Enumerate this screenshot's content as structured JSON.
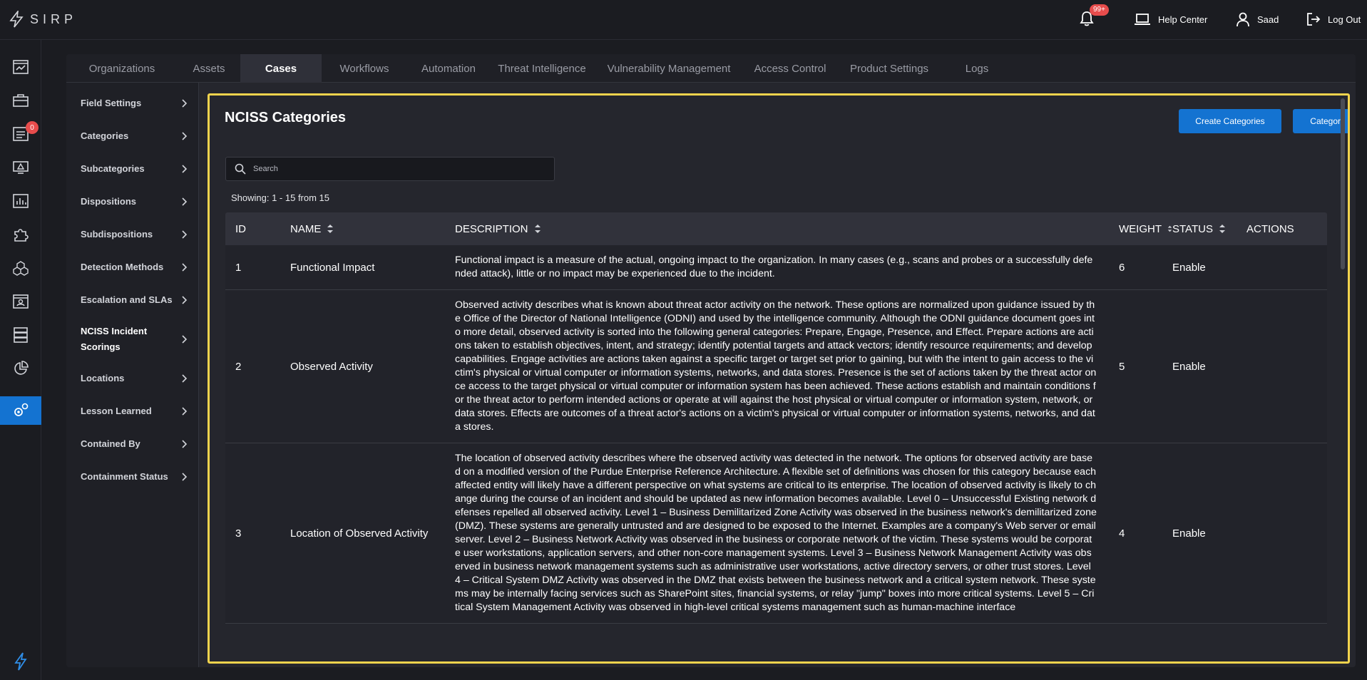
{
  "app": {
    "logo_text": "SIRP"
  },
  "topbar": {
    "notifications_badge": "99+",
    "help_label": "Help Center",
    "user_label": "Saad",
    "logout_label": "Log Out"
  },
  "rail": {
    "cases_badge": "0"
  },
  "tabs": [
    {
      "label": "Organizations"
    },
    {
      "label": "Assets"
    },
    {
      "label": "Cases"
    },
    {
      "label": "Workflows"
    },
    {
      "label": "Automation"
    },
    {
      "label": "Threat Intelligence"
    },
    {
      "label": "Vulnerability Management"
    },
    {
      "label": "Access Control"
    },
    {
      "label": "Product Settings"
    },
    {
      "label": "Logs"
    }
  ],
  "subnav": [
    {
      "label": "Field Settings"
    },
    {
      "label": "Categories"
    },
    {
      "label": "Subcategories"
    },
    {
      "label": "Dispositions"
    },
    {
      "label": "Subdispositions"
    },
    {
      "label": "Detection Methods"
    },
    {
      "label": "Escalation and SLAs"
    },
    {
      "label": "NCISS Incident Scorings"
    },
    {
      "label": "Locations"
    },
    {
      "label": "Lesson Learned"
    },
    {
      "label": "Contained By"
    },
    {
      "label": "Containment Status"
    }
  ],
  "panel": {
    "title": "NCISS Categories",
    "create_button": "Create Categories",
    "options_button": "Category Options",
    "search_placeholder": "Search",
    "showing": "Showing: 1 - 15 from 15"
  },
  "table": {
    "headers": {
      "id": "ID",
      "name": "NAME",
      "description": "DESCRIPTION",
      "weight": "WEIGHT",
      "status": "STATUS",
      "actions": "ACTIONS"
    },
    "rows": [
      {
        "id": "1",
        "name": "Functional Impact",
        "description": "Functional impact is a measure of the actual, ongoing impact to the organization. In many cases (e.g., scans and probes or a successfully defended attack), little or no impact may be experienced due to the incident.",
        "weight": "6",
        "status": "Enable"
      },
      {
        "id": "2",
        "name": "Observed Activity",
        "description": "Observed activity describes what is known about threat actor activity on the network. These options are normalized upon guidance issued by the Office of the Director of National Intelligence (ODNI) and used by the intelligence community. Although the ODNI guidance document goes into more detail, observed activity is sorted into the following general categories: Prepare, Engage, Presence, and Effect. Prepare actions are actions taken to establish objectives, intent, and strategy; identify potential targets and attack vectors; identify resource requirements; and develop capabilities. Engage activities are actions taken against a specific target or target set prior to gaining, but with the intent to gain access to the victim's physical or virtual computer or information systems, networks, and data stores. Presence is the set of actions taken by the threat actor once access to the target physical or virtual computer or information system has been achieved. These actions establish and maintain conditions for the threat actor to perform intended actions or operate at will against the host physical or virtual computer or information system, network, or data stores. Effects are outcomes of a threat actor's actions on a victim's physical or virtual computer or information systems, networks, and data stores.",
        "weight": "5",
        "status": "Enable"
      },
      {
        "id": "3",
        "name": "Location of Observed Activity",
        "description": "The location of observed activity describes where the observed activity was detected in the network. The options for observed activity are based on a modified version of the Purdue Enterprise Reference Architecture. A flexible set of definitions was chosen for this category because each affected entity will likely have a different perspective on what systems are critical to its enterprise. The location of observed activity is likely to change during the course of an incident and should be updated as new information becomes available. Level 0 – Unsuccessful Existing network defenses repelled all observed activity. Level 1 – Business Demilitarized Zone Activity was observed in the business network's demilitarized zone (DMZ). These systems are generally untrusted and are designed to be exposed to the Internet. Examples are a company's Web server or email server. Level 2 – Business Network Activity was observed in the business or corporate network of the victim. These systems would be corporate user workstations, application servers, and other non-core management systems. Level 3 – Business Network Management Activity was observed in business network management systems such as administrative user workstations, active directory servers, or other trust stores. Level 4 – Critical System DMZ Activity was observed in the DMZ that exists between the business network and a critical system network. These systems may be internally facing services such as SharePoint sites, financial systems, or relay \"jump\" boxes into more critical systems. Level 5 – Critical System Management Activity was observed in high-level critical systems management such as human-machine interface",
        "weight": "4",
        "status": "Enable"
      }
    ]
  },
  "colors": {
    "accent": "#1473d1",
    "highlight_border": "#f2d34d",
    "badge": "#e74c4c",
    "background": "#1b1c21"
  }
}
